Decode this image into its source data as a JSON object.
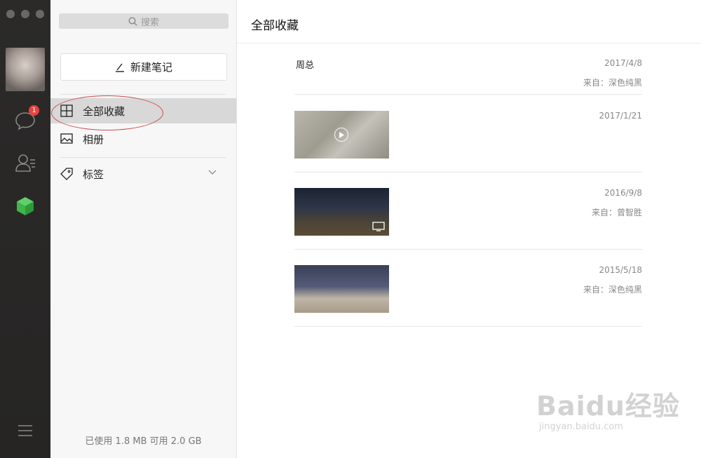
{
  "rail": {
    "chat_badge": "1"
  },
  "sidebar": {
    "search_placeholder": "搜索",
    "new_note_label": "新建笔记",
    "items": [
      {
        "label": "全部收藏",
        "icon": "grid-icon",
        "active": true
      },
      {
        "label": "相册",
        "icon": "image-icon",
        "active": false
      },
      {
        "label": "标签",
        "icon": "tag-icon",
        "active": false
      }
    ],
    "storage_text": "已使用 1.8 MB 可用 2.0 GB"
  },
  "main": {
    "title": "全部收藏",
    "entries": [
      {
        "type": "note",
        "title": "周总",
        "date": "2017/4/8",
        "source": "来自：深色纯黑"
      },
      {
        "type": "video",
        "date": "2017/1/21"
      },
      {
        "type": "video",
        "date": "2016/9/8",
        "source": "来自：曾智胜"
      },
      {
        "type": "image",
        "date": "2015/5/18",
        "source": "来自：深色纯黑"
      }
    ]
  },
  "watermark": {
    "logo": "Baidu经验",
    "url": "jingyan.baidu.com"
  },
  "colors": {
    "rail_bg": "#2b2a29",
    "accent_green": "#3fb54a",
    "badge_red": "#e64340",
    "annotation_red": "#d14a4a"
  }
}
